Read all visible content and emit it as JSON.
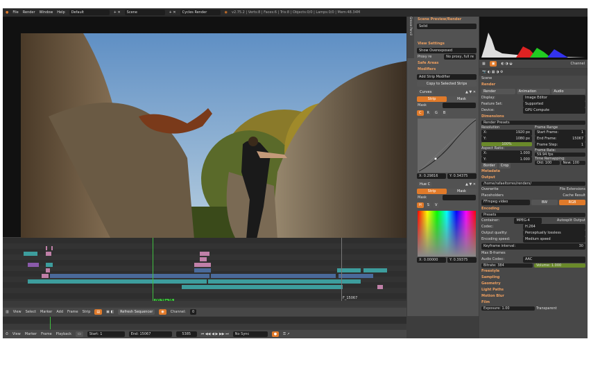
{
  "topbar": {
    "blender_icon": "blender-icon",
    "menus": [
      "File",
      "Render",
      "Window",
      "Help"
    ],
    "layout": "Default",
    "scene": "Scene",
    "engine": "Cycles Render",
    "stats": "v2.75.2 | Verts:8 | Faces:6 | Tris:8 | Objects:0/0 | Lamps:0/0 | Mem:48.34M"
  },
  "preview": {
    "side_tab": "Grease Pencil"
  },
  "seqprops": {
    "sec_scene_preview": "Scene Preview/Render",
    "solid": "Solid",
    "sec_view": "View Settings",
    "show": "Show Overexposed",
    "proxy_label": "Proxy re",
    "proxy_value": "No proxy, full re",
    "sec_safe": "Safe Areas",
    "sec_modifiers": "Modifiers",
    "add_mod": "Add Strip Modifier",
    "copy_sel": "Copy to Selected Strips",
    "curves": {
      "name": "Curves",
      "tab_strip": "Strip",
      "tab_mask": "Mask",
      "mask_label": "Mask",
      "x": "X: 0.29816",
      "y": "Y: 0.34375"
    },
    "huecorr": {
      "name": "Hue C",
      "tab_strip": "Strip",
      "tab_mask": "Mask",
      "mask_label": "Mask",
      "x": "X: 0.00000",
      "y": "Y: 0.39375"
    }
  },
  "scopes": {
    "channel_label": "Channel"
  },
  "props": {
    "scene": "Scene",
    "render": {
      "title": "Render",
      "tabs": [
        "Render",
        "Animation",
        "Audio"
      ],
      "display_label": "Display:",
      "display_value": "Image Editor",
      "fs_label": "Feature Set:",
      "fs_value": "Supported",
      "device_label": "Device:",
      "device_value": "GPU Compute"
    },
    "dims": {
      "title": "Dimensions",
      "presets": "Render Presets",
      "res_title": "Resolution",
      "x_label": "X:",
      "x_value": "1920 px",
      "y_label": "Y:",
      "y_value": "1080 px",
      "percent": "100%",
      "fr_title": "Frame Range",
      "start_label": "Start Frame:",
      "start_value": "1",
      "end_label": "End Frame:",
      "end_value": "15067",
      "step_label": "Frame Step:",
      "step_value": "1",
      "aspect_title": "Aspect Ratio:",
      "ax_label": "X:",
      "ax_value": "1.000",
      "ay_label": "Y:",
      "ay_value": "1.000",
      "border": "Border",
      "crop": "Crop",
      "rate_title": "Frame Rate:",
      "rate_value": "59.94 fps",
      "remap_title": "Time Remapping:",
      "old_label": "Old:",
      "old_value": "100",
      "new_label": "New:",
      "new_value": "100"
    },
    "metadata": "Metadata",
    "output": {
      "title": "Output",
      "path": "/home/rafaeltorres/renders/",
      "overwrite": "Overwrite",
      "file_ext": "File Extensions",
      "placeholders": "Placeholders",
      "cache": "Cache Result",
      "format": "FFmpeg video",
      "bw": "BW",
      "rgb": "RGB"
    },
    "encoding": {
      "title": "Encoding",
      "presets": "Presets",
      "container_label": "Container:",
      "container_value": "MPEG-4",
      "autosplit": "Autosplit Output",
      "codec_label": "Codec:",
      "codec_value": "H.264",
      "quality_label": "Output quality:",
      "quality_value": "Perceptually lossless",
      "speed_label": "Encoding speed:",
      "speed_value": "Medium speed",
      "keyframe_label": "Keyframe interval:",
      "keyframe_value": "30",
      "bframes": "Max B-frames",
      "audio_label": "Audio Codec:",
      "audio_value": "AAC",
      "bitrate_label": "Bitrate:",
      "bitrate_value": "384",
      "volume_label": "Volume:",
      "volume_value": "1.000"
    },
    "collapsed": [
      "Freestyle",
      "Sampling",
      "Geometry",
      "Light Paths",
      "Motion Blur",
      "Film"
    ],
    "film": {
      "exposure_label": "Exposure:",
      "exposure_value": "1.00",
      "transparent": "Transparent"
    }
  },
  "sequencer": {
    "current_frame": "00:39+26",
    "end_marker": "F_15067",
    "header": {
      "menus": [
        "View",
        "Select",
        "Marker",
        "Add",
        "Frame",
        "Strip"
      ],
      "refresh": "Refresh Sequencer",
      "channel_label": "Channel:",
      "channel_value": "0"
    }
  },
  "timeline": {
    "menus": [
      "View",
      "Marker",
      "Frame",
      "Playback"
    ],
    "start_label": "Start:",
    "start_value": "1",
    "end_label": "End:",
    "end_value": "15067",
    "current": "5385",
    "sync": "No Sync"
  },
  "colors": {
    "accent": "#e07a2a",
    "playhead": "#40c040",
    "strip_teal": "#3d9d9d",
    "strip_pink": "#c080a8",
    "strip_blue": "#4a6a9a",
    "strip_purple": "#8a5aaa"
  }
}
